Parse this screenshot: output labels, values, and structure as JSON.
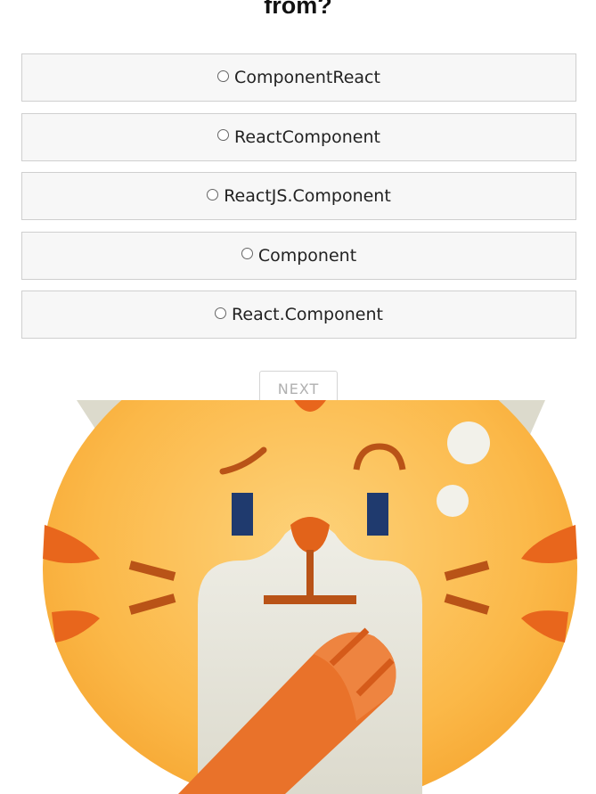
{
  "question": {
    "title_fragment": "from?"
  },
  "options": [
    {
      "label": "ComponentReact"
    },
    {
      "label": "ReactComponent"
    },
    {
      "label": "ReactJS.Component"
    },
    {
      "label": "Component"
    },
    {
      "label": "React.Component"
    }
  ],
  "actions": {
    "next_label": "NEXT"
  },
  "illustration": {
    "icon": "confused-cat-icon",
    "colors": {
      "fur": "#fbb040",
      "stripes": "#e8661c",
      "muzzle": "#ecebe3",
      "eyes": "#1f3a6e",
      "finger": "#e9722a"
    }
  }
}
